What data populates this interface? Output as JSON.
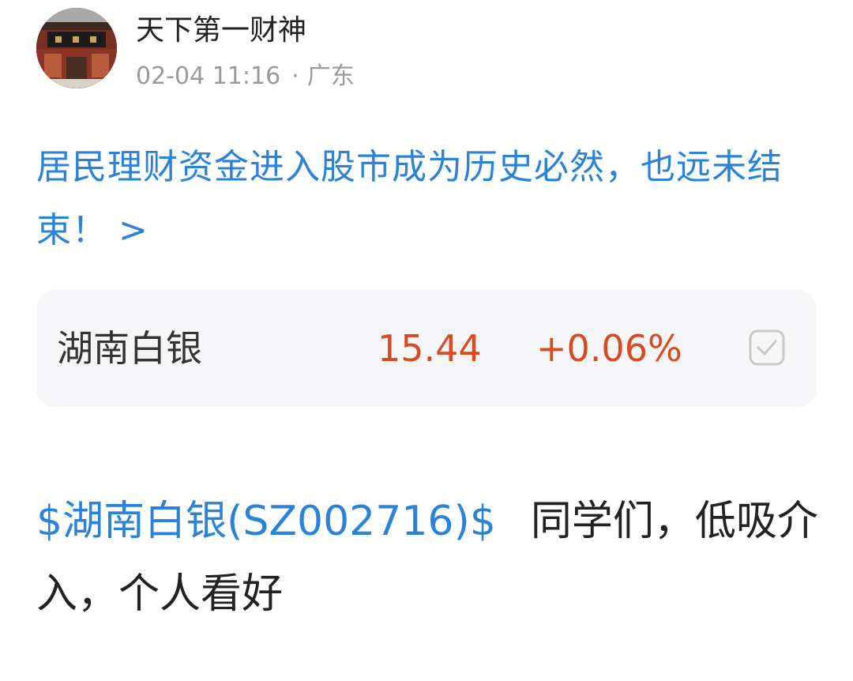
{
  "author": {
    "name": "天下第一财神",
    "date": "02-04 11:16",
    "separator": "·",
    "location": "广东"
  },
  "article": {
    "title": "居民理财资金进入股市成为历史必然，也远未结束！",
    "chevron": ">"
  },
  "stock": {
    "name": "湖南白银",
    "price": "15.44",
    "change": "+0.06%",
    "change_color": "#d84a1f"
  },
  "post": {
    "stock_tag": "$湖南白银(SZ002716)$",
    "text": "同学们，低吸介入，个人看好"
  },
  "colors": {
    "link": "#2a82d9",
    "up": "#d84a1f",
    "card_bg": "#f6f6f8"
  }
}
